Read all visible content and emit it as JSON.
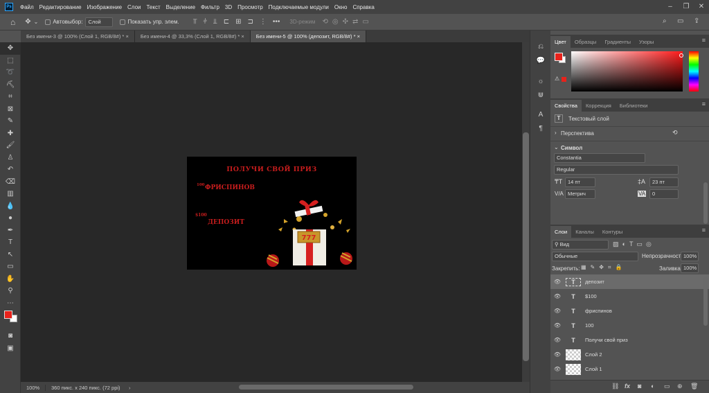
{
  "menubar": {
    "logo": "Ps",
    "items": [
      "Файл",
      "Редактирование",
      "Изображение",
      "Слои",
      "Текст",
      "Выделение",
      "Фильтр",
      "3D",
      "Просмотр",
      "Подключаемые модули",
      "Окно",
      "Справка"
    ],
    "window_controls": [
      "minimize-icon",
      "restore-icon",
      "close-icon"
    ]
  },
  "options": {
    "autoselect_label": "Автовыбор:",
    "autoselect_value": "Слой",
    "show_controls_label": "Показать упр. элем.",
    "mode_3d": "3D-режим"
  },
  "tabs": [
    {
      "label": "Без имени-3 @ 100% (Слой 1, RGB/8#) *",
      "close": "×"
    },
    {
      "label": "Без имени-4 @ 33,3% (Слой 1, RGB/8#) *",
      "close": "×"
    },
    {
      "label": "Без имени-5 @ 100% (депозит, RGB/8#) *",
      "close": "×"
    }
  ],
  "canvas": {
    "headline": "ПОЛУЧИ СВОЙ ПРИЗ",
    "num100": "100",
    "freespins": "ФРИСПИНОВ",
    "dollar100": "$100",
    "deposit": "ДЕПОЗИТ",
    "slot": "777"
  },
  "status": {
    "zoom": "100%",
    "docinfo": "360 пикс. x 240 пикс. (72 ppi)",
    "arrow": "›"
  },
  "colorpanel": {
    "tabs": [
      "Цвет",
      "Образцы",
      "Градиенты",
      "Узоры"
    ],
    "fg": "#e8221b",
    "bg": "#ffffff"
  },
  "props": {
    "tabs": [
      "Свойства",
      "Коррекция",
      "Библиотеки"
    ],
    "layer_type": "Текстовый слой",
    "perspective": "Перспектива",
    "symbol": "Символ",
    "font": "Constantia",
    "style": "Regular",
    "size": "14 пт",
    "leading": "23 пт",
    "kerning": "Метрич",
    "tracking": "0"
  },
  "layers": {
    "tabs": [
      "Слои",
      "Каналы",
      "Контуры"
    ],
    "filter": "Вид",
    "blend": "Обычные",
    "opacity_label": "Непрозрачность:",
    "opacity": "100%",
    "lock_label": "Закрепить:",
    "fill_label": "Заливка:",
    "fill": "100%",
    "items": [
      {
        "name": "депозит",
        "type": "text",
        "selected": true
      },
      {
        "name": "$100",
        "type": "text"
      },
      {
        "name": "фриспинов",
        "type": "text"
      },
      {
        "name": "100",
        "type": "text"
      },
      {
        "name": "Получи свой приз",
        "type": "text"
      },
      {
        "name": "Слой 2",
        "type": "pixel"
      },
      {
        "name": "Слой 1",
        "type": "pixel"
      }
    ],
    "footer": [
      "link-icon",
      "fx-icon",
      "mask-icon",
      "adjustment-icon",
      "folder-icon",
      "new-layer-icon",
      "trash-icon"
    ],
    "fx": "fx"
  },
  "glyphs": {
    "T": "T",
    "move": "✥",
    "chev": "⌄",
    "dots": "•••"
  },
  "colors": {
    "accent": "#e8221b",
    "panel": "#535353",
    "dark": "#424242",
    "canvas_bg": "#282828"
  }
}
